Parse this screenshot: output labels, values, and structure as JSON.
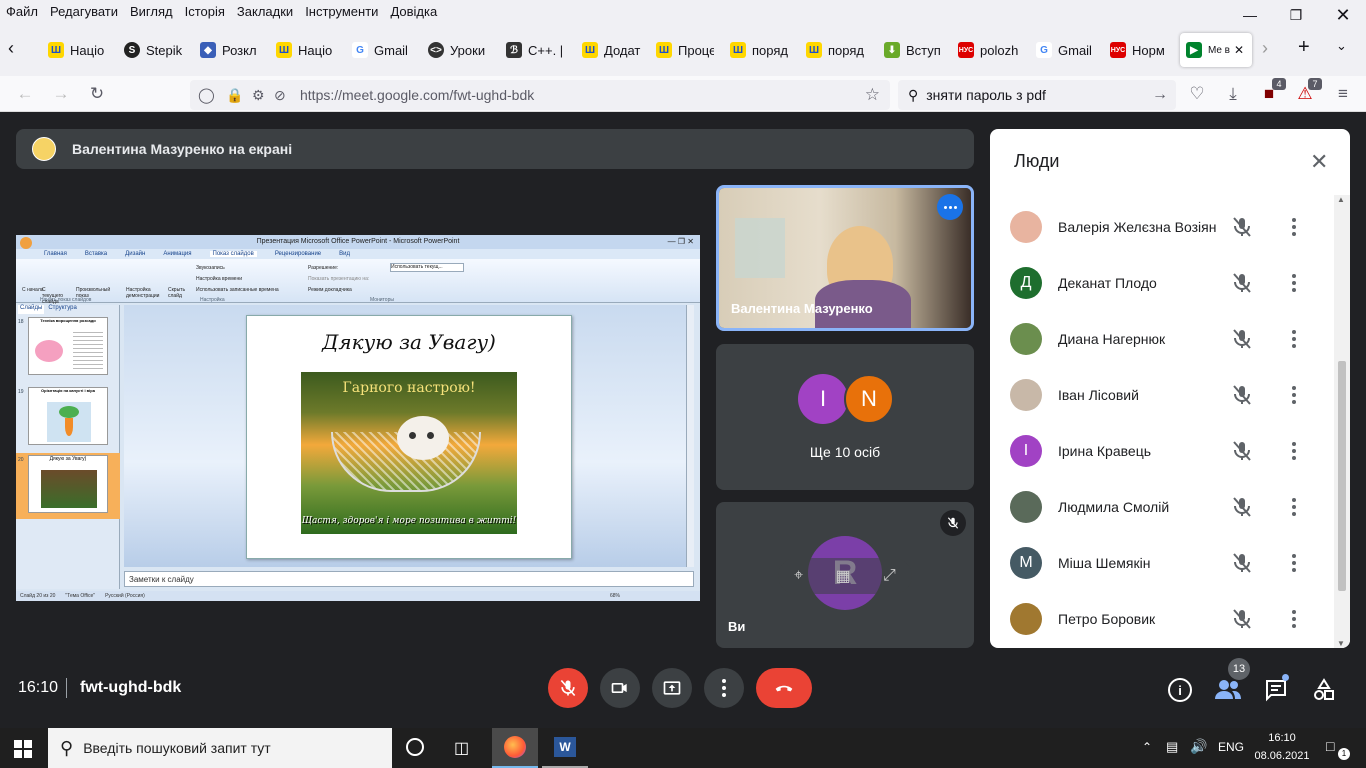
{
  "menubar": {
    "items": [
      "Файл",
      "Редагувати",
      "Вигляд",
      "Історія",
      "Закладки",
      "Інструменти",
      "Довідка"
    ]
  },
  "tabs": [
    {
      "label": "Націо",
      "icon": "trident-icon"
    },
    {
      "label": "Stepik",
      "icon": "stepik-icon"
    },
    {
      "label": "Розкл",
      "icon": "shield-icon"
    },
    {
      "label": "Націо",
      "icon": "trident-icon"
    },
    {
      "label": "Gmail",
      "icon": "google-icon"
    },
    {
      "label": "Уроки",
      "icon": "code-icon"
    },
    {
      "label": "C++. |",
      "icon": "cpp-icon"
    },
    {
      "label": "Додат",
      "icon": "trident-icon"
    },
    {
      "label": "Проце",
      "icon": "trident-icon"
    },
    {
      "label": "поряд",
      "icon": "trident-icon"
    },
    {
      "label": "поряд",
      "icon": "trident-icon"
    },
    {
      "label": "Вступ",
      "icon": "download-icon"
    },
    {
      "label": "polozh",
      "icon": "nuc-icon"
    },
    {
      "label": "Gmail",
      "icon": "google-icon"
    },
    {
      "label": "Норм",
      "icon": "nuc-icon"
    },
    {
      "label": "Me відт",
      "icon": "meet-icon"
    }
  ],
  "nav": {
    "url": "https://meet.google.com/fwt-ughd-bdk",
    "search": "зняти пароль з pdf",
    "badge_ublock": "4",
    "badge_shield": "7"
  },
  "meet": {
    "banner": "Валентина Мазуренко на екрані",
    "presentation": {
      "window_title": "Презентация Microsoft Office PowerPoint - Microsoft PowerPoint",
      "ribbon_tabs": [
        "Главная",
        "Вставка",
        "Дизайн",
        "Анимация",
        "Показ слайдов",
        "Рецензирование",
        "Вид"
      ],
      "ribbon_items": [
        "С начала",
        "С текущего слайда",
        "Произвольный показ",
        "Настройка демонстрации",
        "Скрыть слайд",
        "Звукозапись",
        "Настройка времени",
        "Использовать записанные времена",
        "Разрешение:",
        "Использовать текущ...",
        "Показать презентацию на:",
        "Режим докладчика",
        "Начать показ слайдов",
        "Настройка",
        "Мониторы"
      ],
      "pane_tabs": [
        "Слайды",
        "Структура"
      ],
      "thumbs": [
        {
          "num": "18",
          "title": "Техніка вирощення розсади"
        },
        {
          "num": "19",
          "title": "Орієнтація на капусті і віра"
        },
        {
          "num": "20",
          "title": "Дякую за Увагу)"
        }
      ],
      "slide_title": "Дякую за Увагу)",
      "slide_top_text": "Гарного настрою!",
      "slide_bottom_text": "Щастя, здоров'я і море позитива в житті!",
      "notes": "Заметки к слайду",
      "status": [
        "Слайд 20 из 20",
        "\"Тема Office\"",
        "Русский (Россия)",
        "68%"
      ]
    },
    "tiles": {
      "speaker": "Валентина Мазуренко",
      "others_label": "Ще 10 осіб",
      "others_initials": [
        "I",
        "N"
      ],
      "self_label": "Ви",
      "self_initial": "R"
    },
    "people": {
      "title": "Люди",
      "list": [
        {
          "name": "Валерія Желєзна Возіян",
          "initial": "",
          "color": "#e8b4a0",
          "photo": true
        },
        {
          "name": "Деканат Плодо",
          "initial": "Д",
          "color": "#1e6e2e",
          "photo": false
        },
        {
          "name": "Диана Нагернюк",
          "initial": "",
          "color": "#6b8e4e",
          "photo": true
        },
        {
          "name": "Іван Лісовий",
          "initial": "",
          "color": "#c8b8a8",
          "photo": true
        },
        {
          "name": "Ірина Кравець",
          "initial": "I",
          "color": "#a142c4",
          "photo": false
        },
        {
          "name": "Людмила Смолій",
          "initial": "",
          "color": "#5a6a5a",
          "photo": true
        },
        {
          "name": "Міша Шемякін",
          "initial": "M",
          "color": "#455a64",
          "photo": false
        },
        {
          "name": "Петро Боровик",
          "initial": "",
          "color": "#a07830",
          "photo": true
        }
      ]
    },
    "bottom": {
      "time": "16:10",
      "code": "fwt-ughd-bdk",
      "people_count": "13"
    }
  },
  "taskbar": {
    "search_placeholder": "Введіть пошуковий запит тут",
    "lang": "ENG",
    "time": "16:10",
    "date": "08.06.2021",
    "notif_count": "1"
  }
}
